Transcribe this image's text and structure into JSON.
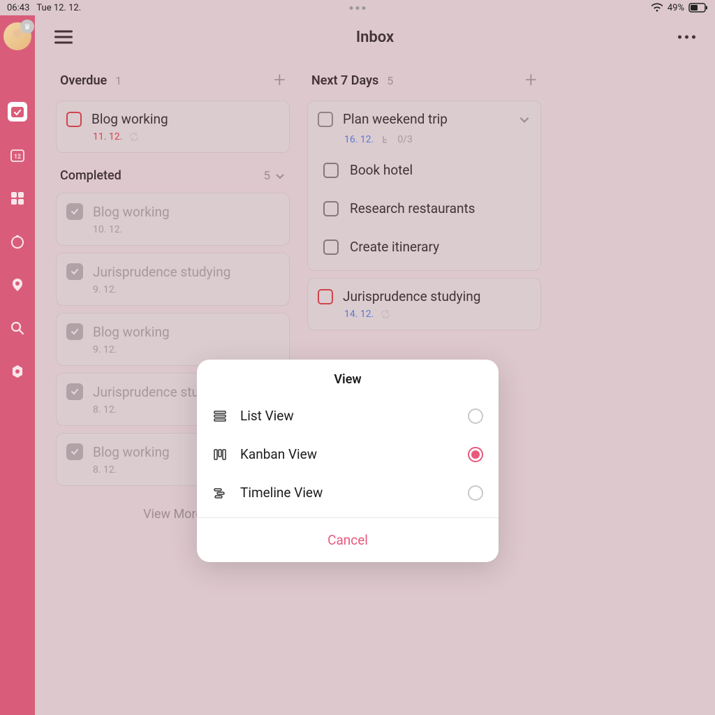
{
  "status": {
    "time": "06:43",
    "date": "Tue 12. 12.",
    "battery": "49%"
  },
  "header": {
    "title": "Inbox"
  },
  "columns": {
    "overdue": {
      "title": "Overdue",
      "count": "1",
      "items": [
        {
          "title": "Blog working",
          "date": "11. 12."
        }
      ]
    },
    "completed": {
      "title": "Completed",
      "count": "5",
      "items": [
        {
          "title": "Blog working",
          "date": "10. 12."
        },
        {
          "title": "Jurisprudence studying",
          "date": "9. 12."
        },
        {
          "title": "Blog working",
          "date": "9. 12."
        },
        {
          "title": "Jurisprudence studying",
          "date": "8. 12."
        },
        {
          "title": "Blog working",
          "date": "8. 12."
        }
      ],
      "view_more": "View More"
    },
    "next7": {
      "title": "Next 7 Days",
      "count": "5",
      "items": [
        {
          "title": "Plan weekend trip",
          "date": "16. 12.",
          "progress": "0/3",
          "subtasks": [
            "Book hotel",
            "Research restaurants",
            "Create itinerary"
          ]
        },
        {
          "title": "Jurisprudence studying",
          "date": "14. 12."
        }
      ]
    }
  },
  "modal": {
    "title": "View",
    "options": [
      {
        "label": "List View",
        "selected": false
      },
      {
        "label": "Kanban View",
        "selected": true
      },
      {
        "label": "Timeline View",
        "selected": false
      }
    ],
    "cancel": "Cancel"
  }
}
